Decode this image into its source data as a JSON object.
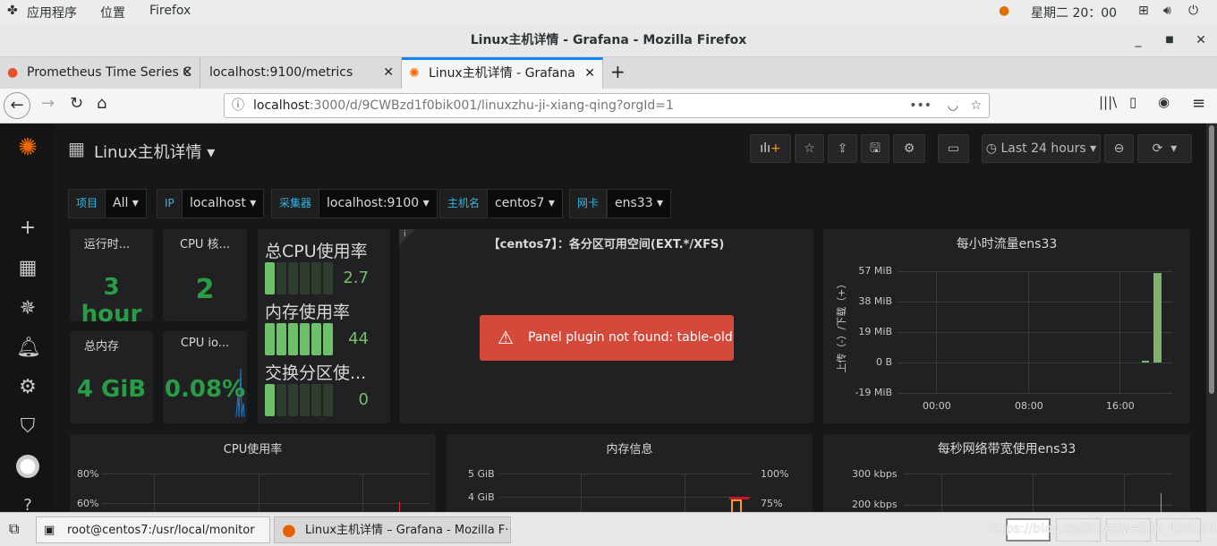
{
  "gnome": {
    "apps": "应用程序",
    "places": "位置",
    "firefox": "Firefox",
    "clock": "星期二 20：00"
  },
  "window": {
    "title": "Linux主机详情  -  Grafana - Mozilla Firefox"
  },
  "tabs": [
    {
      "label": "Prometheus Time Series C"
    },
    {
      "label": "localhost:9100/metrics"
    },
    {
      "label": "Linux主机详情 - Grafana",
      "active": true
    }
  ],
  "url": {
    "host": "localhost",
    "rest": ":3000/d/9CWBzd1f0bik001/linuxzhu-ji-xiang-qing?orgId=1"
  },
  "dashboard": {
    "title": "Linux主机详情",
    "time_range": "Last 24 hours"
  },
  "variables": [
    {
      "label": "项目",
      "value": "All"
    },
    {
      "label": "IP",
      "value": "localhost"
    },
    {
      "label": "采集器",
      "value": "localhost:9100"
    },
    {
      "label": "主机名",
      "value": "centos7"
    },
    {
      "label": "网卡",
      "value": "ens33"
    }
  ],
  "stats": [
    {
      "title": "运行时...",
      "value": "3 hour"
    },
    {
      "title": "CPU 核...",
      "value": "2"
    },
    {
      "title": "总内存",
      "value": "4 GiB"
    },
    {
      "title": "CPU io...",
      "value": "0.08%"
    }
  ],
  "gauges": [
    {
      "title": "总CPU使用率",
      "value": "2.7",
      "level": 0.027
    },
    {
      "title": "内存使用率",
      "value": "44",
      "level": 1.0
    },
    {
      "title": "交换分区使...",
      "value": "0",
      "level": 0.0
    }
  ],
  "table_panel": {
    "title": "【centos7】：各分区可用空间(EXT.*/XFS)",
    "error": "Panel plugin not found: table-old",
    "info": "i"
  },
  "traffic": {
    "title": "每小时流量ens33",
    "ylabel": "上传（-）/下载（+）",
    "yticks": [
      "57 MiB",
      "38 MiB",
      "19 MiB",
      "0 B",
      "-19 MiB"
    ],
    "xticks": [
      "00:00",
      "08:00",
      "16:00"
    ],
    "bars_mib": [
      1,
      56
    ]
  },
  "cpu_panel": {
    "title": "CPU使用率",
    "yticks": [
      "80%",
      "60%"
    ]
  },
  "mem_panel": {
    "title": "内存信息",
    "yticks": [
      "5 GiB",
      "4 GiB"
    ],
    "y2ticks": [
      "100%",
      "75%"
    ]
  },
  "net_panel": {
    "title": "每秒网络带宽使用ens33",
    "yticks": [
      "300 kbps",
      "200 kbps"
    ]
  },
  "taskbar": {
    "terminal": "root@centos7:/usr/local/monitor",
    "firefox": "Linux主机详情 – Grafana - Mozilla F···",
    "watermark": "https://blog.csdn.net/weixin_43810415"
  },
  "colors": {
    "green": "#299c46",
    "error": "#d44a3a",
    "bar": "#7eb26d"
  }
}
